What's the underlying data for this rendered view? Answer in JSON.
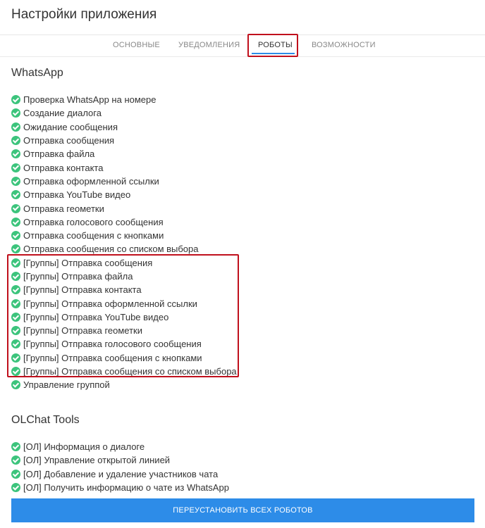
{
  "app": {
    "title": "Настройки приложения"
  },
  "tabs": [
    {
      "label": "ОСНОВНЫЕ"
    },
    {
      "label": "УВЕДОМЛЕНИЯ"
    },
    {
      "label": "РОБОТЫ",
      "active": true
    },
    {
      "label": "ВОЗМОЖНОСТИ"
    }
  ],
  "sections": {
    "whatsapp": {
      "title": "WhatsApp",
      "items": [
        "Проверка WhatsApp на номере",
        "Создание диалога",
        "Ожидание сообщения",
        "Отправка сообщения",
        "Отправка файла",
        "Отправка контакта",
        "Отправка оформленной ссылки",
        "Отправка YouTube видео",
        "Отправка геометки",
        "Отправка голосового сообщения",
        "Отправка сообщения с кнопками",
        "Отправка сообщения со списком выбора",
        "[Группы] Отправка сообщения",
        "[Группы] Отправка файла",
        "[Группы] Отправка контакта",
        "[Группы] Отправка оформленной ссылки",
        "[Группы] Отправка YouTube видео",
        "[Группы] Отправка геометки",
        "[Группы] Отправка голосового сообщения",
        "[Группы] Отправка сообщения с кнопками",
        "[Группы] Отправка сообщения со списком выбора",
        "Управление группой"
      ]
    },
    "olchat": {
      "title": "OLChat Tools",
      "items": [
        "[ОЛ] Информация о диалоге",
        "[ОЛ] Управление открытой линией",
        "[ОЛ] Добавление и удаление участников чата",
        "[ОЛ] Получить информацию о чате из WhatsApp"
      ]
    }
  },
  "actions": {
    "reinstall_label": "ПЕРЕУСТАНОВИТЬ ВСЕХ РОБОТОВ"
  },
  "colors": {
    "accent": "#2d8ce8",
    "check": "#3cc47c",
    "highlight": "#c0101c"
  },
  "icons": {
    "robot_status": "check-circle-icon"
  }
}
